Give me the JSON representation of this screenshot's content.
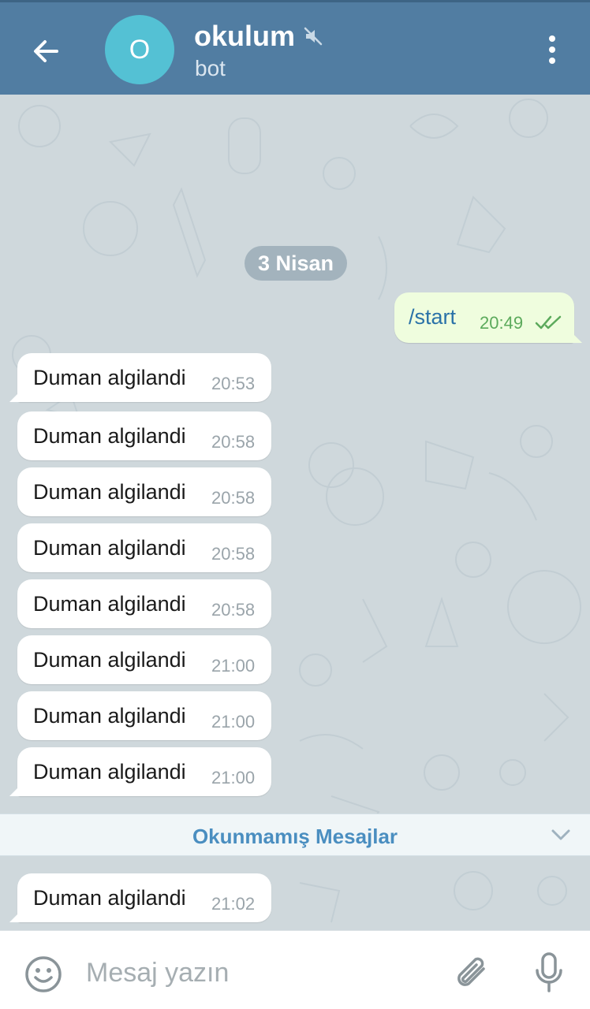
{
  "header": {
    "avatar_letter": "O",
    "title": "okulum",
    "subtitle": "bot",
    "muted_icon": "muted-speaker-icon",
    "back_icon": "arrow-left-icon",
    "menu_icon": "more-vertical-icon"
  },
  "chat": {
    "date_pill": "3 Nisan",
    "outgoing": {
      "text": "/start",
      "time": "20:49",
      "status": "read-double-check"
    },
    "incoming_before_unread": [
      {
        "text": "Duman algilandi",
        "time": "20:53"
      },
      {
        "text": "Duman algilandi",
        "time": "20:58"
      },
      {
        "text": "Duman algilandi",
        "time": "20:58"
      },
      {
        "text": "Duman algilandi",
        "time": "20:58"
      },
      {
        "text": "Duman algilandi",
        "time": "20:58"
      },
      {
        "text": "Duman algilandi",
        "time": "21:00"
      },
      {
        "text": "Duman algilandi",
        "time": "21:00"
      },
      {
        "text": "Duman algilandi",
        "time": "21:00"
      }
    ],
    "unread_label": "Okunmamış Mesajlar",
    "incoming_after_unread": [
      {
        "text": "Duman algilandi",
        "time": "21:02"
      }
    ]
  },
  "composer": {
    "placeholder": "Mesaj yazın",
    "emoji_icon": "emoji-icon",
    "attach_icon": "paperclip-icon",
    "mic_icon": "microphone-icon"
  },
  "colors": {
    "header_bg": "#517da2",
    "avatar_bg": "#54c1d4",
    "chat_bg": "#cfd8dc",
    "outgoing_bubble": "#effdde",
    "unread_text": "#4a8ec0"
  }
}
